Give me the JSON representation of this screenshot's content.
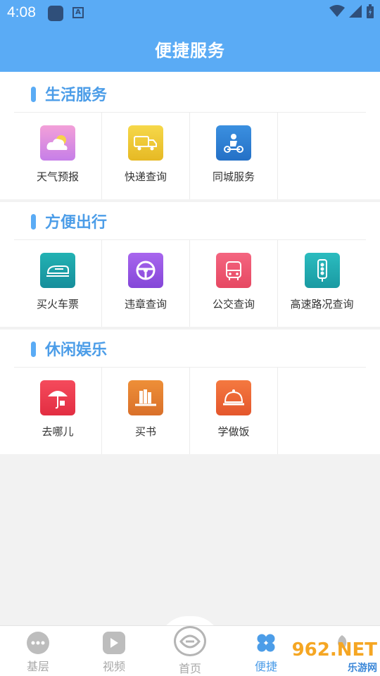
{
  "status": {
    "time": "4:08",
    "keyboard_label": "A"
  },
  "header": {
    "title": "便捷服务",
    "bg_color": "#5aabf5"
  },
  "sections": [
    {
      "title": "生活服务",
      "items": [
        {
          "label": "天气预报",
          "icon": "weather-icon",
          "color": "#e98ad6"
        },
        {
          "label": "快递查询",
          "icon": "delivery-truck-icon",
          "color": "#f0cc3a"
        },
        {
          "label": "同城服务",
          "icon": "scooter-icon",
          "color": "#2f86d9"
        }
      ]
    },
    {
      "title": "方便出行",
      "items": [
        {
          "label": "买火车票",
          "icon": "train-icon",
          "color": "#1fa6a8"
        },
        {
          "label": "违章查询",
          "icon": "steering-wheel-icon",
          "color": "#9a5ae6"
        },
        {
          "label": "公交查询",
          "icon": "bus-icon",
          "color": "#f05a72"
        },
        {
          "label": "高速路况查询",
          "icon": "traffic-light-icon",
          "color": "#23b1b6"
        }
      ]
    },
    {
      "title": "休闲娱乐",
      "items": [
        {
          "label": "去哪儿",
          "icon": "umbrella-icon",
          "color": "#ee3d4f"
        },
        {
          "label": "买书",
          "icon": "books-icon",
          "color": "#e8812f"
        },
        {
          "label": "学做饭",
          "icon": "cloche-icon",
          "color": "#f06a36"
        }
      ]
    }
  ],
  "bottom_nav": [
    {
      "label": "基层",
      "icon": "more-dots-icon",
      "active": false
    },
    {
      "label": "视频",
      "icon": "play-icon",
      "active": false
    },
    {
      "label": "首页",
      "icon": "home-logo-icon",
      "active": false
    },
    {
      "label": "便捷",
      "icon": "four-petal-icon",
      "active": true
    },
    {
      "label": "",
      "icon": "leaf-icon",
      "active": false
    }
  ],
  "watermark": {
    "brand": "962.NET",
    "sub": "乐游网"
  }
}
